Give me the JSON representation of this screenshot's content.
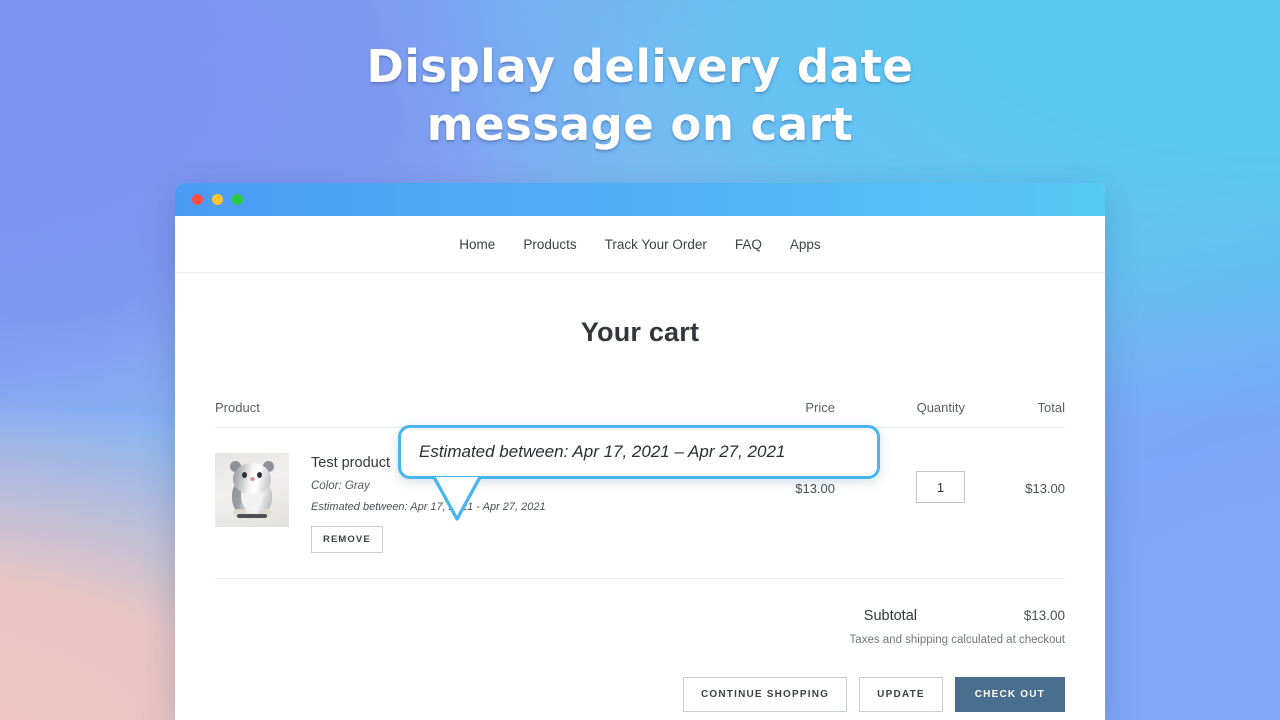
{
  "promo": {
    "headline_line1": "Display delivery date",
    "headline_line2": "message on cart",
    "headline_color": "#ffffff"
  },
  "browser": {
    "traffic_lights": [
      {
        "name": "close",
        "color": "#ff4f45"
      },
      {
        "name": "minimize",
        "color": "#fec42c"
      },
      {
        "name": "maximize",
        "color": "#29cc41"
      }
    ],
    "titlebar_gradient_from": "#4b9bf6",
    "titlebar_gradient_to": "#56c9f5"
  },
  "site_nav": {
    "items": [
      {
        "label": "Home"
      },
      {
        "label": "Products"
      },
      {
        "label": "Track Your Order"
      },
      {
        "label": "FAQ"
      },
      {
        "label": "Apps"
      }
    ]
  },
  "cart": {
    "title": "Your cart",
    "columns": {
      "product": "Product",
      "price": "Price",
      "quantity": "Quantity",
      "total": "Total"
    },
    "items": [
      {
        "title": "Test product",
        "variant": "Color: Gray",
        "estimate": "Estimated between: Apr 17, 2021 - Apr 27, 2021",
        "remove_label": "REMOVE",
        "price": "$13.00",
        "quantity": "1",
        "quantity_placeholder": "1",
        "total": "$13.00",
        "thumbnail": "plush-hamster-toy-photo"
      }
    ],
    "subtotal_label": "Subtotal",
    "subtotal_value": "$13.00",
    "tax_note": "Taxes and shipping calculated at checkout",
    "actions": {
      "continue_shopping": "CONTINUE SHOPPING",
      "update": "UPDATE",
      "check_out": "CHECK OUT",
      "primary_color": "#4a6f8e"
    }
  },
  "callout": {
    "text": "Estimated between: Apr 17, 2021 – Apr 27, 2021",
    "border_color": "#45b6ee"
  }
}
